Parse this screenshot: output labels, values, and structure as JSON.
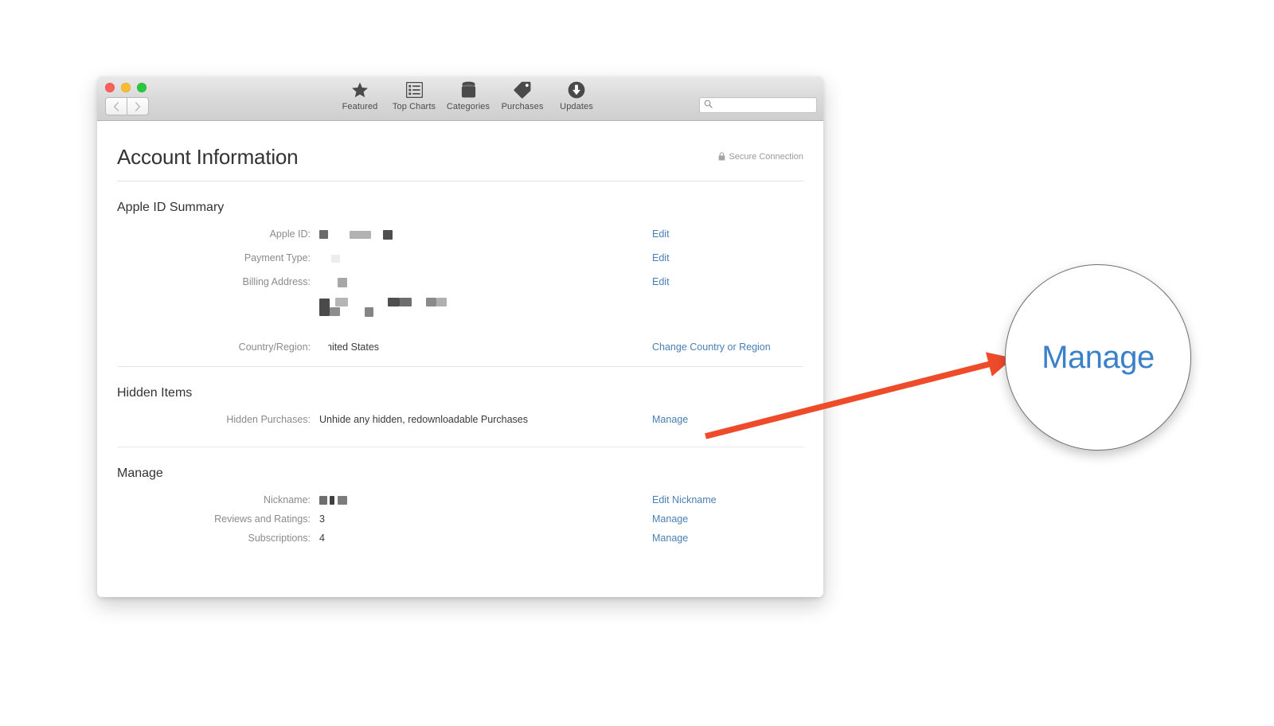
{
  "window": {
    "traffic_lights": [
      "close",
      "minimize",
      "zoom"
    ],
    "nav": {
      "back_label": "Back",
      "forward_label": "Forward"
    },
    "toolbar_items": [
      {
        "label": "Featured",
        "icon": "star-icon"
      },
      {
        "label": "Top Charts",
        "icon": "list-icon"
      },
      {
        "label": "Categories",
        "icon": "stack-icon"
      },
      {
        "label": "Purchases",
        "icon": "tag-icon"
      },
      {
        "label": "Updates",
        "icon": "download-circle-icon"
      }
    ],
    "search": {
      "value": "",
      "placeholder": ""
    }
  },
  "page": {
    "title": "Account Information",
    "secure_connection": "Secure Connection"
  },
  "sections": [
    {
      "title": "Apple ID Summary",
      "rows": [
        {
          "label": "Apple ID:",
          "value": "",
          "redacted": true,
          "action": "Edit"
        },
        {
          "label": "Payment Type:",
          "value": "",
          "redacted": true,
          "action": "Edit"
        },
        {
          "label": "Billing Address:",
          "value": "",
          "redacted": true,
          "action": "Edit"
        },
        {
          "label": "Country/Region:",
          "value": "United States",
          "redacted": false,
          "action": "Change Country or Region"
        }
      ]
    },
    {
      "title": "Hidden Items",
      "rows": [
        {
          "label": "Hidden Purchases:",
          "value": "Unhide any hidden, redownloadable Purchases",
          "redacted": false,
          "action": "Manage"
        }
      ]
    },
    {
      "title": "Manage",
      "rows": [
        {
          "label": "Nickname:",
          "value": "",
          "redacted": true,
          "action": "Edit Nickname"
        },
        {
          "label": "Reviews and Ratings:",
          "value": "3",
          "redacted": false,
          "action": "Manage"
        },
        {
          "label": "Subscriptions:",
          "value": "4",
          "redacted": false,
          "action": "Manage"
        }
      ]
    }
  ],
  "callout": {
    "magnified_label": "Manage",
    "arrow_color": "#EE4B2B",
    "link_color": "#4A7FB5"
  }
}
